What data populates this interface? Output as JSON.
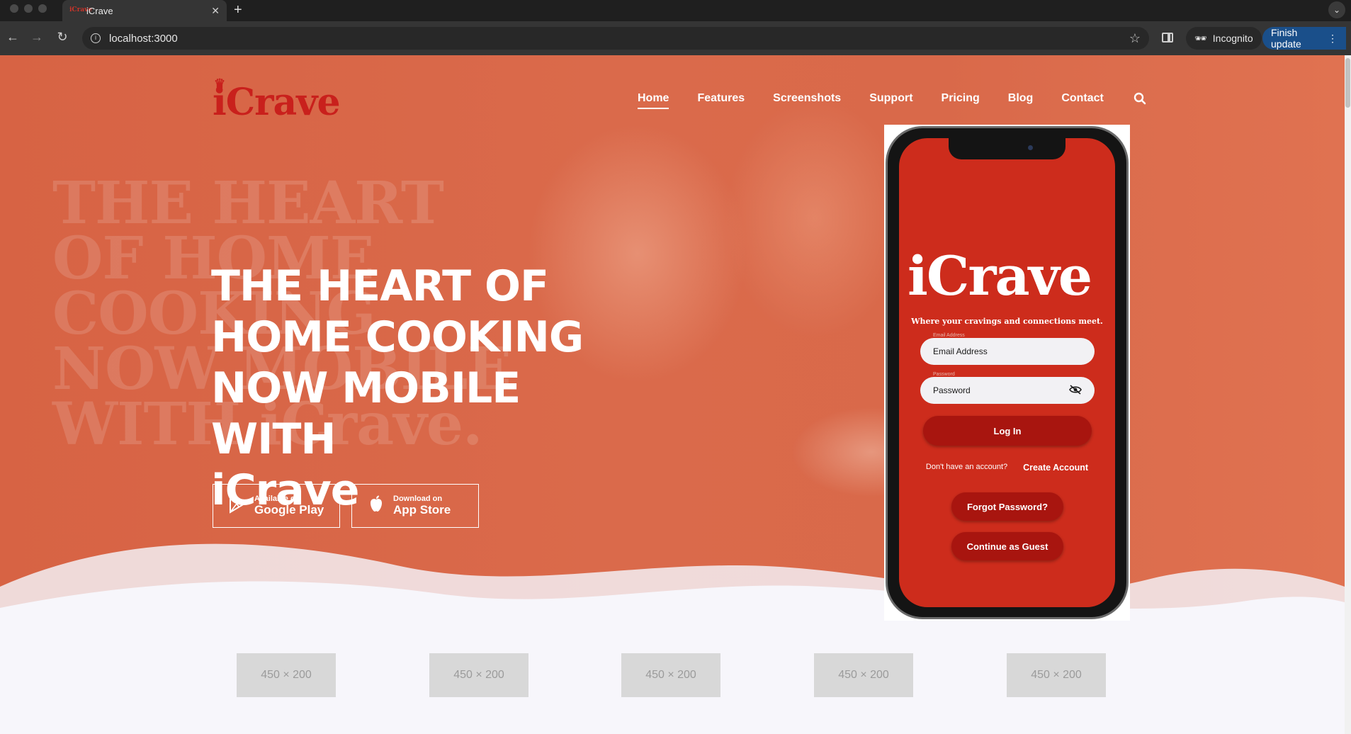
{
  "browser": {
    "tab_title": "iCrave",
    "favicon_text": "iCrave",
    "new_tab": "+",
    "url": "localhost:3000",
    "incognito_label": "Incognito",
    "finish_update_label": "Finish update"
  },
  "site": {
    "logo": "iCrave",
    "nav": {
      "home": "Home",
      "features": "Features",
      "screenshots": "Screenshots",
      "support": "Support",
      "pricing": "Pricing",
      "blog": "Blog",
      "contact": "Contact"
    },
    "ghost_lines": [
      "THE HEART",
      "OF HOME",
      "COOKING",
      "NOW MOBILE",
      "WITH iCrave."
    ],
    "headline_lines": [
      "THE HEART OF",
      "HOME COOKING",
      "NOW MOBILE WITH",
      "iCrave"
    ],
    "google_play": {
      "small": "Available on",
      "big": "Google Play"
    },
    "app_store": {
      "small": "Download on",
      "big": "App Store"
    }
  },
  "phone": {
    "logo": "iCrave",
    "tagline": "Where your cravings and connections meet.",
    "email_label": "Email Address",
    "email_placeholder": "Email Address",
    "password_label": "Password",
    "password_placeholder": "Password",
    "login": "Log In",
    "no_account": "Don't have an account?",
    "create_account": "Create Account",
    "forgot_password": "Forgot Password?",
    "continue_guest": "Continue as Guest"
  },
  "placeholders": [
    "450 × 200",
    "450 × 200",
    "450 × 200",
    "450 × 200",
    "450 × 200"
  ],
  "colors": {
    "hero": "#d9694a",
    "brand_red": "#c9201c",
    "phone_screen": "#cd2c1c",
    "button_red": "#a8150f"
  }
}
